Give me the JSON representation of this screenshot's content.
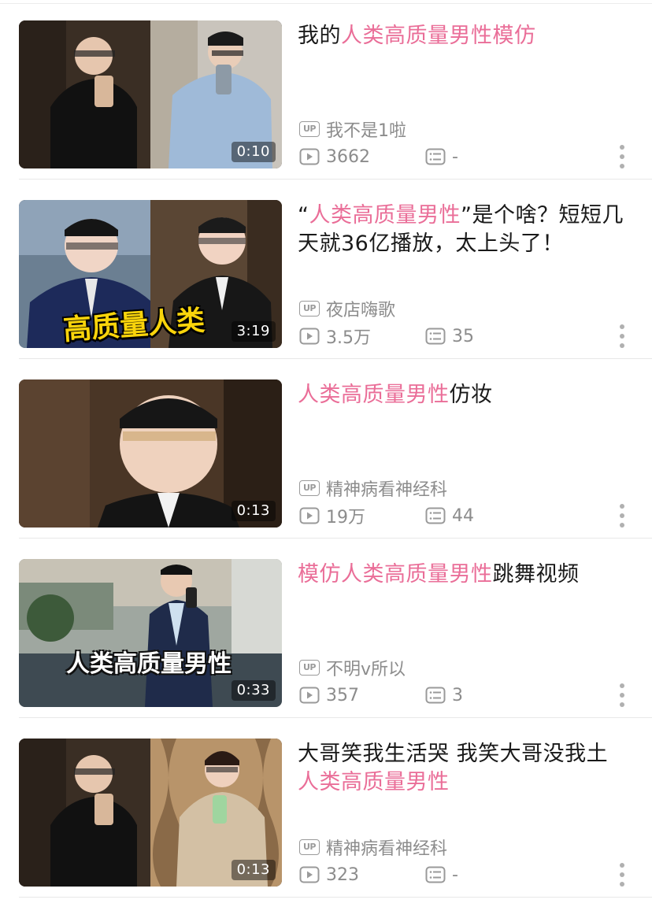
{
  "videos": [
    {
      "title_hl_prefix": "",
      "title_plain_prefix": "我的",
      "title_hl": "人类高质量男性模仿",
      "title_plain_suffix": "",
      "title_line2_plain": "",
      "title_line2_hl": "",
      "uploader": "我不是1啦",
      "views": "3662",
      "danmaku": "-",
      "duration": "0:10",
      "overlay_text": ""
    },
    {
      "title_plain_prefix": "“",
      "title_hl": "人类高质量男性",
      "title_plain_suffix": "”是个啥？短短几天就36亿播放，太上头了！",
      "title_line2_plain": "",
      "title_line2_hl": "",
      "uploader": "夜店嗨歌",
      "views": "3.5万",
      "danmaku": "35",
      "duration": "3:19",
      "overlay_text": "高质量人类"
    },
    {
      "title_plain_prefix": "",
      "title_hl": "人类高质量男性",
      "title_plain_suffix": "仿妆",
      "title_line2_plain": "",
      "title_line2_hl": "",
      "uploader": "精神病看神经科",
      "views": "19万",
      "danmaku": "44",
      "duration": "0:13",
      "overlay_text": ""
    },
    {
      "title_plain_prefix": "",
      "title_hl": "模仿人类高质量男性",
      "title_plain_suffix": "跳舞视频",
      "title_line2_plain": "",
      "title_line2_hl": "",
      "uploader": "不明v所以",
      "views": "357",
      "danmaku": "3",
      "duration": "0:33",
      "overlay_text": "人类高质量男性"
    },
    {
      "title_plain_prefix": "大哥笑我生活哭 我笑大哥没我土",
      "title_hl": "",
      "title_plain_suffix": "",
      "title_line2_plain": "",
      "title_line2_hl": "人类高质量男性",
      "uploader": "精神病看神经科",
      "views": "323",
      "danmaku": "-",
      "duration": "0:13",
      "overlay_text": ""
    }
  ],
  "labels": {
    "up_badge": "UP"
  },
  "icons": {
    "up": "up-badge-icon",
    "play": "play-count-icon",
    "danmaku": "danmaku-count-icon",
    "more": "more-vertical-icon"
  },
  "colors": {
    "highlight": "#ea6e98",
    "meta": "#8c8c8c",
    "divider": "#e8e8e8"
  }
}
